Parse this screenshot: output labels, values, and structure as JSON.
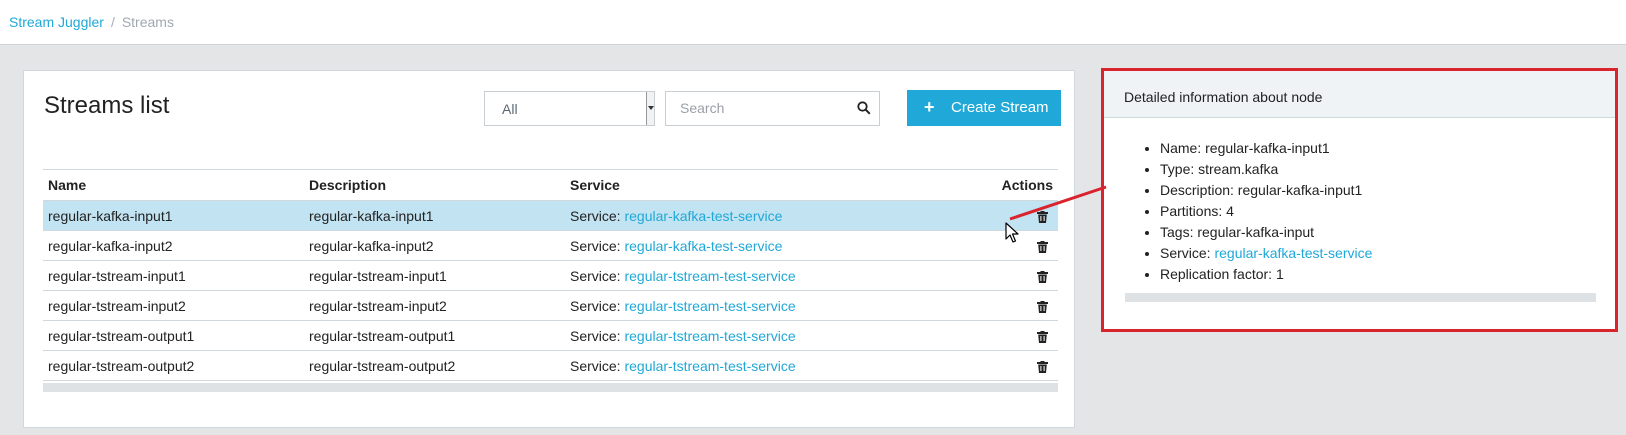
{
  "breadcrumb": {
    "root": "Stream Juggler",
    "separator": "/",
    "current": "Streams"
  },
  "streams_card": {
    "title": "Streams list",
    "filter": {
      "selected": "All"
    },
    "search": {
      "placeholder": "Search",
      "value": ""
    },
    "create_button": {
      "icon": "plus-icon",
      "label": "Create Stream"
    },
    "columns": [
      "Name",
      "Description",
      "Service",
      "Actions"
    ],
    "rows": [
      {
        "name": "regular-kafka-input1",
        "description": "regular-kafka-input1",
        "service_prefix": "Service:",
        "service": "regular-kafka-test-service",
        "selected": true
      },
      {
        "name": "regular-kafka-input2",
        "description": "regular-kafka-input2",
        "service_prefix": "Service:",
        "service": "regular-kafka-test-service"
      },
      {
        "name": "regular-tstream-input1",
        "description": "regular-tstream-input1",
        "service_prefix": "Service:",
        "service": "regular-tstream-test-service"
      },
      {
        "name": "regular-tstream-input2",
        "description": "regular-tstream-input2",
        "service_prefix": "Service:",
        "service": "regular-tstream-test-service"
      },
      {
        "name": "regular-tstream-output1",
        "description": "regular-tstream-output1",
        "service_prefix": "Service:",
        "service": "regular-tstream-test-service"
      },
      {
        "name": "regular-tstream-output2",
        "description": "regular-tstream-output2",
        "service_prefix": "Service:",
        "service": "regular-tstream-test-service"
      }
    ]
  },
  "detail_card": {
    "header": "Detailed information about node",
    "name": "Name: regular-kafka-input1",
    "type": "Type: stream.kafka",
    "description": "Description: regular-kafka-input1",
    "partitions": "Partitions: 4",
    "tags": "Tags: regular-kafka-input",
    "service_prefix": "Service:",
    "service": "regular-kafka-test-service",
    "replication": "Replication factor: 1"
  },
  "colors": {
    "accent": "#20a8d8",
    "highlight_border": "#d9232d",
    "selected_row": "#c2e3f2"
  }
}
